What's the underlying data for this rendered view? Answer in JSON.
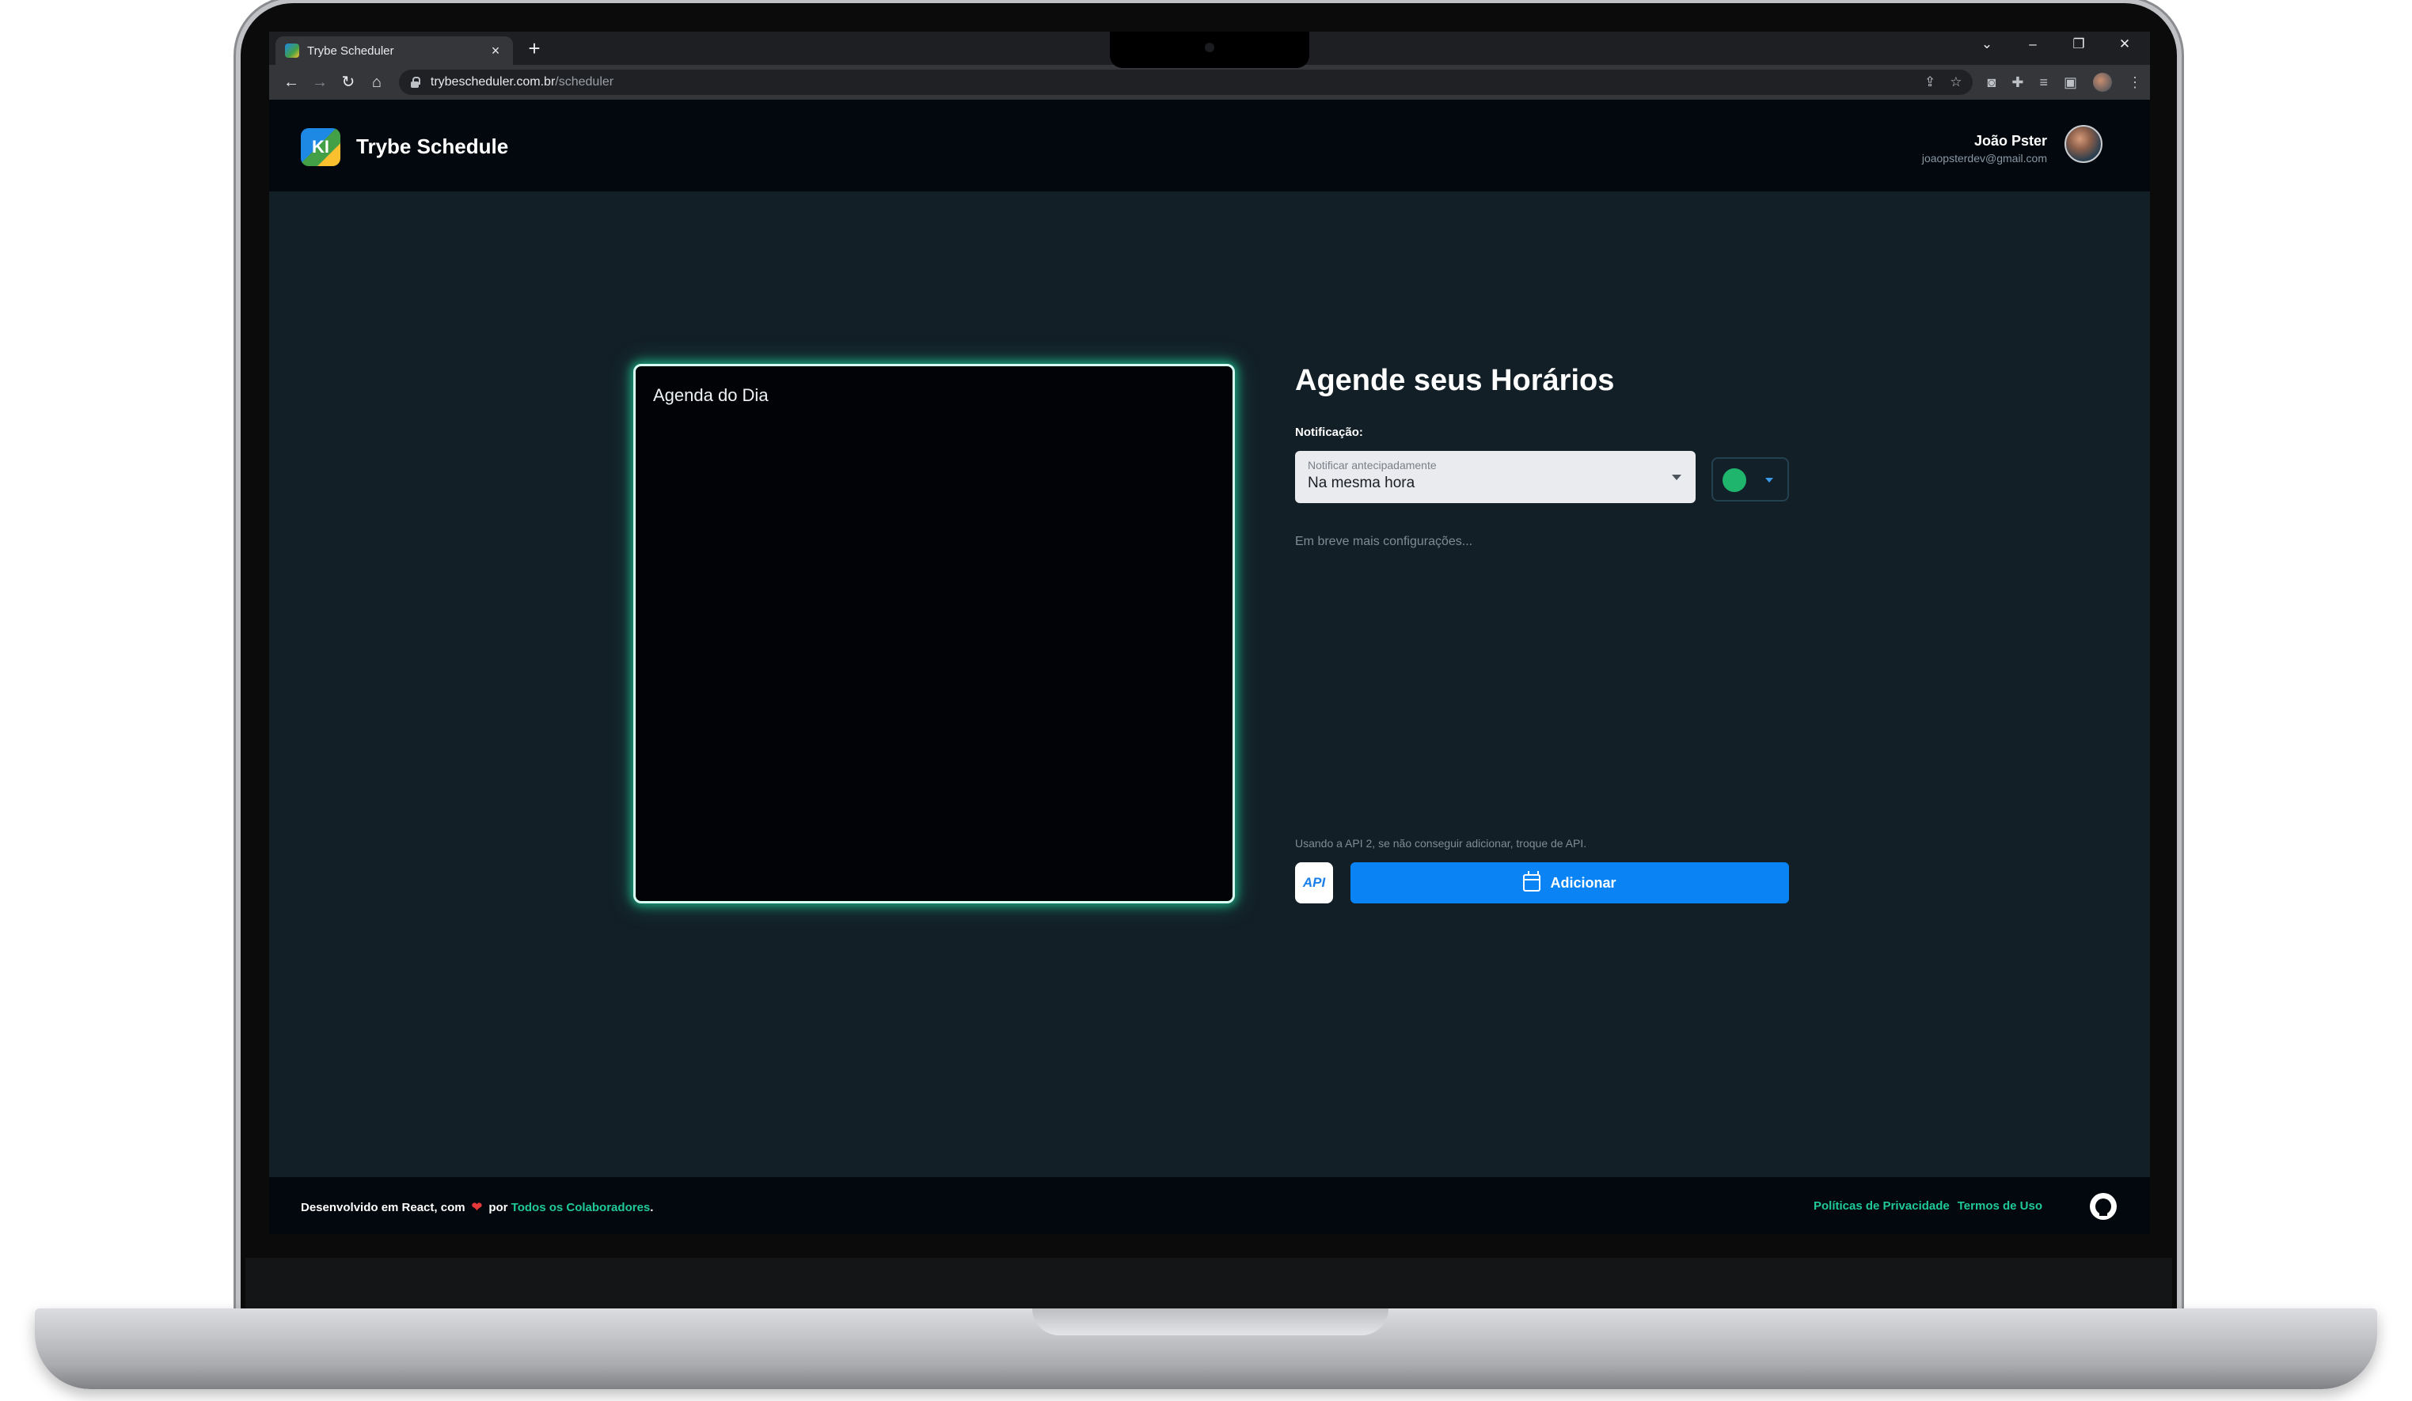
{
  "browser": {
    "tab_title": "Trybe Scheduler",
    "tab_close": "×",
    "new_tab": "+",
    "url_host": "trybescheduler.com.br",
    "url_path": "/scheduler",
    "window_controls": {
      "collapse": "⌄",
      "minimize": "–",
      "restore": "❐",
      "close": "✕"
    }
  },
  "header": {
    "brand_name": "Trybe Schedule",
    "user_name": "João Pster",
    "user_email": "joaopsterdev@gmail.com"
  },
  "agenda": {
    "title": "Agenda do Dia"
  },
  "scheduler": {
    "title": "Agende seus Horários",
    "notification_label": "Notificação:",
    "select_label": "Notificar antecipadamente",
    "select_value": "Na mesma hora",
    "selected_color": "#1fb56d",
    "coming_soon": "Em breve mais configurações...",
    "api_note": "Usando a API 2, se não conseguir adicionar, troque de API.",
    "api_button_label": "API",
    "add_button_label": "Adicionar"
  },
  "footer": {
    "developed_text": "Desenvolvido em React, com",
    "by_text": "por",
    "collaborators_link": "Todos os Colaboradores",
    "period": ".",
    "privacy_link": "Políticas de Privacidade",
    "terms_link": "Termos de Uso"
  },
  "icons": {
    "back": "back-arrow-icon",
    "forward": "forward-arrow-icon",
    "reload": "reload-icon",
    "home": "home-icon",
    "lock": "lock-icon",
    "share": "share-icon",
    "star": "star-icon",
    "calendar": "calendar-icon",
    "heart": "heart-icon",
    "github": "github-icon"
  }
}
